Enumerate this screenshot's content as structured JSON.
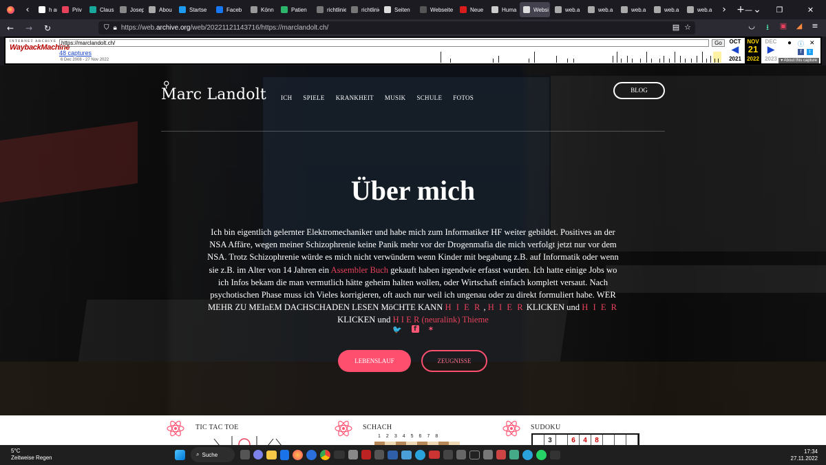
{
  "tabs": [
    {
      "label": "h au",
      "color": "#ffffff",
      "icon": "page-icon"
    },
    {
      "label": "Priv",
      "color": "#e8415b",
      "icon": "privacy-icon"
    },
    {
      "label": "Claus",
      "color": "#19a89c",
      "icon": "site-icon"
    },
    {
      "label": "Josep",
      "color": "#888888",
      "icon": "shield-icon"
    },
    {
      "label": "Abou",
      "color": "#aaaaaa",
      "icon": "page-icon"
    },
    {
      "label": "Startse",
      "color": "#1d9bf0",
      "icon": "twitter-icon"
    },
    {
      "label": "Faceb",
      "color": "#1877f2",
      "icon": "facebook-icon"
    },
    {
      "label": "Könn",
      "color": "#999999",
      "icon": "page-icon"
    },
    {
      "label": "Patien",
      "color": "#2db56c",
      "icon": "pi-icon"
    },
    {
      "label": "richtlinien",
      "color": "#777777",
      "icon": "page-icon"
    },
    {
      "label": "richtlinien",
      "color": "#777777",
      "icon": "page-icon"
    },
    {
      "label": "Seiten",
      "color": "#dddddd",
      "icon": "info-icon"
    },
    {
      "label": "Webseite",
      "color": "#555555",
      "icon": "page-icon"
    },
    {
      "label": "Neue",
      "color": "#d91c1c",
      "icon": "z-icon"
    },
    {
      "label": "Huma",
      "color": "#cccccc",
      "icon": "globe-icon"
    },
    {
      "label": "Websi",
      "color": "#dddddd",
      "icon": "page-icon",
      "active": true
    },
    {
      "label": "web.a",
      "color": "#aaaaaa",
      "icon": "dot-icon"
    },
    {
      "label": "web.a",
      "color": "#aaaaaa",
      "icon": "dot-icon"
    },
    {
      "label": "web.a",
      "color": "#aaaaaa",
      "icon": "dot-icon"
    },
    {
      "label": "web.a",
      "color": "#aaaaaa",
      "icon": "dot-icon"
    },
    {
      "label": "web.a",
      "color": "#aaaaaa",
      "icon": "dot-icon"
    }
  ],
  "browser": {
    "url_prefix": "https://web.",
    "url_domain": "archive.org",
    "url_rest": "/web/20221121143716/https://marclandolt.ch/"
  },
  "wayback": {
    "logo_top": "INTERNET ARCHIVE",
    "logo_main": "WaybackMachine",
    "url_input": "https://marclandolt.ch/",
    "go_label": "Go",
    "captures": "48 captures",
    "range": "6 Dec 2008 - 27 Nov 2022",
    "months": [
      "OCT",
      "NOV",
      "DEC"
    ],
    "day": "21",
    "years": [
      "2021",
      "2022",
      "2023"
    ],
    "about": "▾ About this capture"
  },
  "site": {
    "logo": "Marc Landolt",
    "nav": [
      "ICH",
      "SPIELE",
      "KRANKHEIT",
      "MUSIK",
      "SCHULE",
      "FOTOS"
    ],
    "blog": "BLOG",
    "title": "Über mich",
    "intro_1": "Ich bin eigentlich gelernter Elektromechaniker und habe mich zum Informatiker HF weiter gebildet. Positives an der NSA Affäre, wegen meiner Schizophrenie keine Panik mehr vor der Drogenmafia die mich verfolgt jetzt nur vor dem NSA. Trotz Schizophrenie würde es mich nicht verwündern wenn Kinder mit begabung z.B. auf Informatik oder wenn sie z.B. im Alter von 14 Jahren ein ",
    "link_assembler": "Assembler Buch",
    "intro_2": " gekauft haben irgendwie erfasst wurden. Ich hatte einige Jobs wo ich Infos bekam die man vermutlich hätte geheim halten wollen, oder Wirtschaft einfach komplett versaut. Nach psychotischen Phase muss ich Vieles korrigieren, oft auch nur weil ich ungenau oder zu direkt formuliert habe. WER MEHR ZU MEInEM DACHSCHADEN LESEN MöCHTE KANN ",
    "link_hier_1": "H I E R",
    "sep_1": " , ",
    "link_hier_2": "H I E R",
    "text_3": " KLICKEN und ",
    "link_hier_3": "H I E R",
    "text_4": " KLICKEN und ",
    "link_hier_4": "H I E R (neuralink) Thieme",
    "btn_cv": "LEBENSLAUF",
    "btn_zeugnisse": "ZEUGNISSE",
    "social_icons": [
      "twitter-icon",
      "facebook-icon",
      "asterisk-icon"
    ],
    "social_glyphs": [
      "🐦",
      "f",
      "*"
    ],
    "accent": "#ff4f6f"
  },
  "games": {
    "ttt": "TIC TAC TOE",
    "chess": "SCHACH",
    "chess_numbers": [
      "1",
      "2",
      "3",
      "4",
      "5",
      "6",
      "7",
      "8"
    ],
    "sudoku": "SUDOKU",
    "sudoku_row": [
      "",
      "3",
      "",
      "6",
      "4",
      "8",
      "",
      "",
      ""
    ]
  },
  "taskbar": {
    "temp": "5°C",
    "weather": "Zeitweise Regen",
    "search": "Suche",
    "time": "17:34",
    "date": "27.11.2022"
  }
}
